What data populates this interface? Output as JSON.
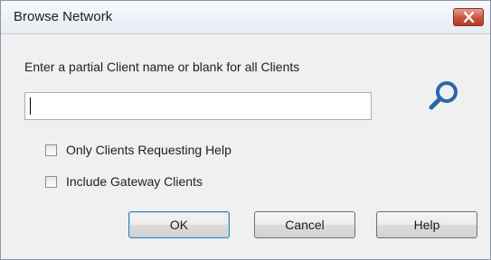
{
  "window": {
    "title": "Browse Network",
    "close_icon": "close-icon"
  },
  "prompt": {
    "text": "Enter a partial Client name or blank for all Clients",
    "icon": "search-icon"
  },
  "client_name_input": {
    "value": "",
    "placeholder": ""
  },
  "options": [
    {
      "label": "Only Clients Requesting Help",
      "checked": false
    },
    {
      "label": "Include Gateway Clients",
      "checked": false
    }
  ],
  "buttons": {
    "ok": "OK",
    "cancel": "Cancel",
    "help": "Help"
  },
  "colors": {
    "close_button": "#c9523c",
    "search_icon": "#2b67a6",
    "default_button_border": "#3c7fb1"
  }
}
